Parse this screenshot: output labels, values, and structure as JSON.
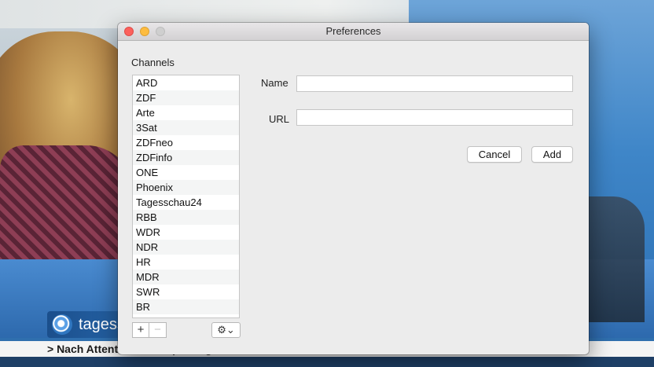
{
  "background": {
    "logo_text": "tagessch",
    "ticker_text": "> Nach Attentat auf Tempelberg: Abbas verurteilt Attentat - Polizei nimmt Grabmal Fest"
  },
  "window": {
    "title": "Preferences"
  },
  "channels": {
    "label": "Channels",
    "items": [
      {
        "label": "ARD"
      },
      {
        "label": "ZDF"
      },
      {
        "label": "Arte"
      },
      {
        "label": "3Sat"
      },
      {
        "label": "ZDFneo"
      },
      {
        "label": "ZDFinfo"
      },
      {
        "label": "ONE"
      },
      {
        "label": "Phoenix"
      },
      {
        "label": "Tagesschau24"
      },
      {
        "label": "RBB"
      },
      {
        "label": "WDR"
      },
      {
        "label": "NDR"
      },
      {
        "label": "HR"
      },
      {
        "label": "MDR"
      },
      {
        "label": "SWR"
      },
      {
        "label": "BR"
      }
    ],
    "add_glyph": "+",
    "remove_glyph": "−",
    "gear_glyph": "⚙︎⌄"
  },
  "form": {
    "name_label": "Name",
    "name_value": "",
    "url_label": "URL",
    "url_value": "",
    "cancel_label": "Cancel",
    "add_label": "Add"
  },
  "colors": {
    "close": "#fc605c",
    "minimize": "#fdbc40",
    "zoom_disabled": "#cfcfcf",
    "window_bg": "#ececec"
  }
}
